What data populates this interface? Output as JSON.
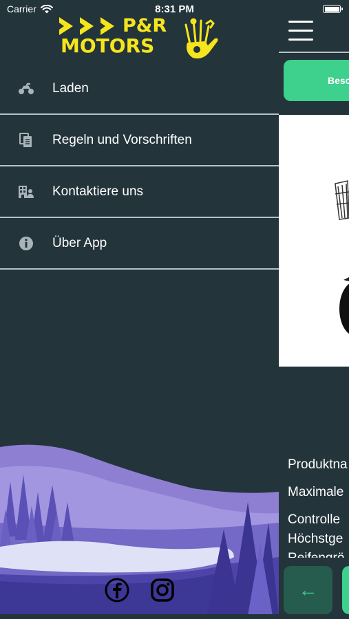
{
  "status_bar": {
    "carrier": "Carrier",
    "time": "8:31 PM",
    "battery_level": 1.0
  },
  "brand": {
    "line1": "P&R",
    "line2": "MOTORS",
    "logo_color": "#f6e51c"
  },
  "menu": {
    "items": [
      {
        "label": "Laden",
        "icon": "motorcycle-icon"
      },
      {
        "label": "Regeln und Vorschriften",
        "icon": "document-icon"
      },
      {
        "label": "Kontaktiere uns",
        "icon": "contact-building-icon"
      },
      {
        "label": "Über App",
        "icon": "info-icon"
      }
    ]
  },
  "social": {
    "items": [
      "facebook-icon",
      "instagram-icon"
    ]
  },
  "main": {
    "button_label": "Besc",
    "specs": [
      "Produktna",
      "Maximale",
      "Controlle",
      "Höchstge",
      "Reifengrö"
    ],
    "accent": "#3ed08d",
    "back_button_arrow": "←"
  },
  "colors": {
    "background": "#23343b",
    "divider": "#b8c3c7"
  }
}
